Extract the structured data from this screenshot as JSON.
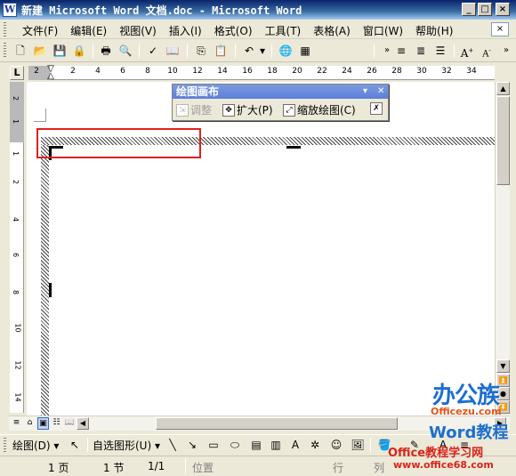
{
  "window": {
    "title": "新建 Microsoft Word 文档.doc - Microsoft Word",
    "icon": "word-doc-icon"
  },
  "menubar": {
    "items": [
      "文件(F)",
      "编辑(E)",
      "视图(V)",
      "插入(I)",
      "格式(O)",
      "工具(T)",
      "表格(A)",
      "窗口(W)",
      "帮助(H)"
    ]
  },
  "toolbar": {
    "icons": [
      "new-icon",
      "open-icon",
      "save-icon",
      "permission-icon",
      "print-icon",
      "print-preview-icon",
      "spelling-icon",
      "research-icon",
      "copy-icon",
      "paste-icon",
      "undo-icon",
      "hyperlink-icon",
      "table-icon",
      "align-left-icon",
      "align-center-icon",
      "grow-font-icon",
      "shrink-font-icon"
    ]
  },
  "ruler": {
    "corner": "L",
    "h_numbers": [
      "2",
      "2",
      "4",
      "6",
      "8",
      "10",
      "12",
      "14",
      "16",
      "18",
      "20",
      "22",
      "24",
      "26",
      "28",
      "30",
      "32",
      "34"
    ],
    "v_numbers": [
      "2",
      "1",
      "1",
      "2",
      "4",
      "6",
      "8",
      "10",
      "12",
      "14"
    ]
  },
  "canvas_toolbar": {
    "title": "绘图画布",
    "fit": "调整",
    "expand": "扩大(P)",
    "scale": "缩放绘图(C)"
  },
  "drawing_toolbar": {
    "draw": "绘图(D)",
    "autoshapes": "自选图形(U)"
  },
  "statusbar": {
    "page": "1 页",
    "section": "1 节",
    "page_of": "1/1",
    "position": "位置",
    "line": "行",
    "column": "列"
  },
  "watermark": {
    "line1": "办公族",
    "line2": "Officezu.com",
    "line3": "Word教程",
    "line4": "Office教程学习网",
    "line5": "www.office68.com"
  },
  "colors": {
    "title_bar": "#0a246a",
    "highlight_box": "#e0201e",
    "watermark_blue": "#1c6fd0",
    "watermark_red": "#d9241b"
  }
}
